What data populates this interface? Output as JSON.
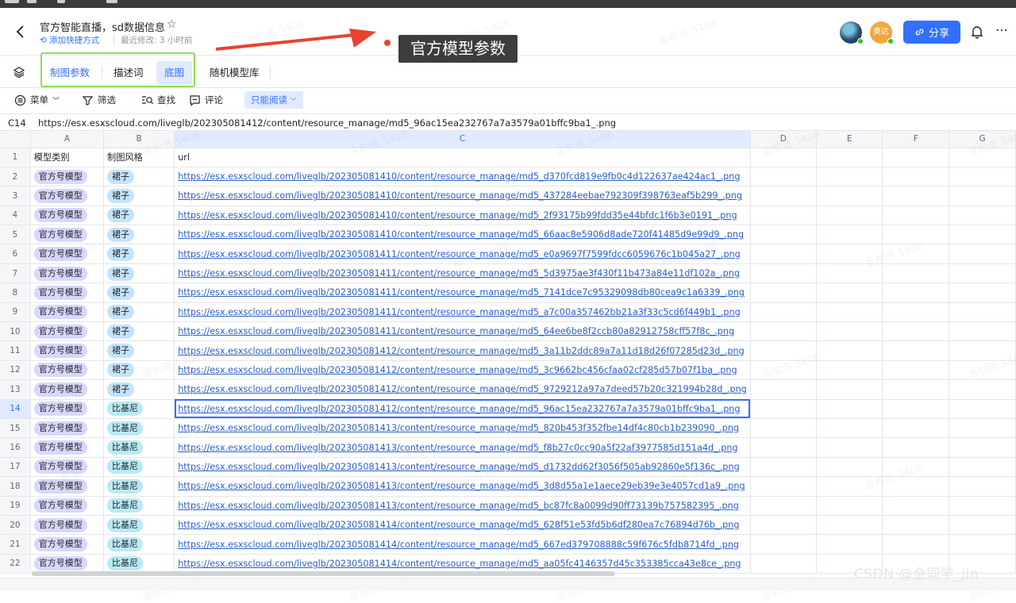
{
  "document": {
    "title": "官方智能直播，sd数据信息",
    "shortcut_label": "添加快捷方式",
    "last_modified": "最近修改: 3 小时前"
  },
  "header": {
    "avatar2_label": "奥达",
    "share_label": "分享"
  },
  "annotation": {
    "callout_text": "官方模型参数",
    "arrow_color": "#e8432f",
    "highlight_color": "#8fdc58"
  },
  "tabs": [
    {
      "label": "制图参数"
    },
    {
      "label": "描述词"
    },
    {
      "label": "底图"
    },
    {
      "label": "随机模型库"
    }
  ],
  "toolbar": {
    "menu": "菜单",
    "filter": "筛选",
    "find": "查找",
    "comment": "评论",
    "mode": "只能阅读"
  },
  "formula_bar": {
    "cell_ref": "C14",
    "value": "https://esx.esxscloud.com/liveglb/202305081412/content/resource_manage/md5_96ac15ea232767a7a3579a01bffc9ba1_.png"
  },
  "grid": {
    "columns": [
      "A",
      "B",
      "C",
      "D",
      "E",
      "F",
      "G"
    ],
    "header_row": {
      "row": "1",
      "a": "模型类别",
      "b": "制图风格",
      "c": "url"
    },
    "rows": [
      {
        "row": "2",
        "a": "官方号模型",
        "b": "裙子",
        "c": "https://esx.esxscloud.com/liveglb/202305081410/content/resource_manage/md5_d370fcd819e9fb0c4d122637ae424ac1_.png"
      },
      {
        "row": "3",
        "a": "官方号模型",
        "b": "裙子",
        "c": "https://esx.esxscloud.com/liveglb/202305081410/content/resource_manage/md5_437284eebae792309f398763eaf5b299_.png"
      },
      {
        "row": "4",
        "a": "官方号模型",
        "b": "裙子",
        "c": "https://esx.esxscloud.com/liveglb/202305081410/content/resource_manage/md5_2f93175b99fdd35e44bfdc1f6b3e0191_.png"
      },
      {
        "row": "5",
        "a": "官方号模型",
        "b": "裙子",
        "c": "https://esx.esxscloud.com/liveglb/202305081410/content/resource_manage/md5_66aac8e5906d8ade720f41485d9e99d9_.png"
      },
      {
        "row": "6",
        "a": "官方号模型",
        "b": "裙子",
        "c": "https://esx.esxscloud.com/liveglb/202305081411/content/resource_manage/md5_e0a9697f7599fdcc6059676c1b045a27_.png"
      },
      {
        "row": "7",
        "a": "官方号模型",
        "b": "裙子",
        "c": "https://esx.esxscloud.com/liveglb/202305081411/content/resource_manage/md5_5d3975ae3f430f11b473a84e11df102a_.png"
      },
      {
        "row": "8",
        "a": "官方号模型",
        "b": "裙子",
        "c": "https://esx.esxscloud.com/liveglb/202305081411/content/resource_manage/md5_7141dce7c95329098db80cea9c1a6339_.png"
      },
      {
        "row": "9",
        "a": "官方号模型",
        "b": "裙子",
        "c": "https://esx.esxscloud.com/liveglb/202305081411/content/resource_manage/md5_a7c00a357462bb21a3f33c5cd6f449b1_.png"
      },
      {
        "row": "10",
        "a": "官方号模型",
        "b": "裙子",
        "c": "https://esx.esxscloud.com/liveglb/202305081411/content/resource_manage/md5_64ee6be8f2ccb80a82912758cff57f8c_.png"
      },
      {
        "row": "11",
        "a": "官方号模型",
        "b": "裙子",
        "c": "https://esx.esxscloud.com/liveglb/202305081412/content/resource_manage/md5_3a11b2ddc89a7a11d18d26f07285d23d_.png"
      },
      {
        "row": "12",
        "a": "官方号模型",
        "b": "裙子",
        "c": "https://esx.esxscloud.com/liveglb/202305081412/content/resource_manage/md5_3c9662bc456cfaa02cf285d57b07f1ba_.png"
      },
      {
        "row": "13",
        "a": "官方号模型",
        "b": "裙子",
        "c": "https://esx.esxscloud.com/liveglb/202305081412/content/resource_manage/md5_9729212a97a7deed57b20c321994b28d_.png"
      },
      {
        "row": "14",
        "a": "官方号模型",
        "b": "比基尼",
        "c": "https://esx.esxscloud.com/liveglb/202305081412/content/resource_manage/md5_96ac15ea232767a7a3579a01bffc9ba1_.png"
      },
      {
        "row": "15",
        "a": "官方号模型",
        "b": "比基尼",
        "c": "https://esx.esxscloud.com/liveglb/202305081413/content/resource_manage/md5_820b453f352fbe14df4c80cb1b239090_.png"
      },
      {
        "row": "16",
        "a": "官方号模型",
        "b": "比基尼",
        "c": "https://esx.esxscloud.com/liveglb/202305081413/content/resource_manage/md5_f8b27c0cc90a5f22af3977585d151a4d_.png"
      },
      {
        "row": "17",
        "a": "官方号模型",
        "b": "比基尼",
        "c": "https://esx.esxscloud.com/liveglb/202305081413/content/resource_manage/md5_d1732dd62f3056f505ab92860e5f136c_.png"
      },
      {
        "row": "18",
        "a": "官方号模型",
        "b": "比基尼",
        "c": "https://esx.esxscloud.com/liveglb/202305081413/content/resource_manage/md5_3d8d55a1e1aece29eb39e3e4057cd1a9_.png"
      },
      {
        "row": "19",
        "a": "官方号模型",
        "b": "比基尼",
        "c": "https://esx.esxscloud.com/liveglb/202305081413/content/resource_manage/md5_bc87fc8a0099d90ff73139b757582395_.png"
      },
      {
        "row": "20",
        "a": "官方号模型",
        "b": "比基尼",
        "c": "https://esx.esxscloud.com/liveglb/202305081414/content/resource_manage/md5_628f51e53fd5b6df280ea7c76894d76b_.png"
      },
      {
        "row": "21",
        "a": "官方号模型",
        "b": "比基尼",
        "c": "https://esx.esxscloud.com/liveglb/202305081414/content/resource_manage/md5_667ed379708888c59f676c5fdb8714fd_.png"
      },
      {
        "row": "22",
        "a": "官方号模型",
        "b": "比基尼",
        "c": "https://esx.esxscloud.com/liveglb/202305081414/content/resource_manage/md5_aa05fc4146357d45c353385cca43e8ce_.png"
      }
    ],
    "selected_row": "14",
    "selected_column": "C"
  },
  "watermark": {
    "text": "金松浩 5406",
    "csdn": "CSDN @金同学_jin"
  },
  "colors": {
    "accent": "#3370ff",
    "tag_category": "#d9d7fb",
    "tag_skirt": "#c5e3fb",
    "tag_bikini": "#b9eaf5"
  }
}
